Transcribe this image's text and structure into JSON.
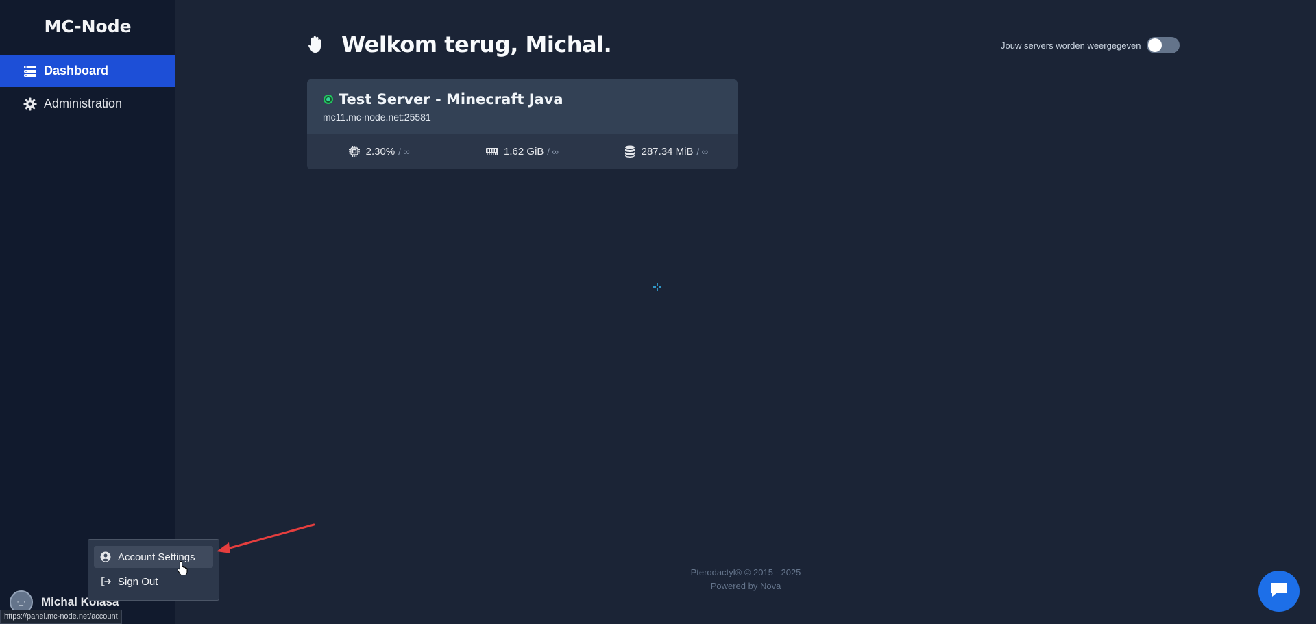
{
  "app": {
    "brand": "MC-Node"
  },
  "sidebar": {
    "items": [
      {
        "label": "Dashboard",
        "icon": "server-stack-icon",
        "active": true
      },
      {
        "label": "Administration",
        "icon": "gear-icon",
        "active": false
      }
    ]
  },
  "user": {
    "name": "Michal Kolasa",
    "avatar_text": "·_·"
  },
  "user_menu": {
    "items": [
      {
        "label": "Account Settings",
        "icon": "user-circle-icon"
      },
      {
        "label": "Sign Out",
        "icon": "sign-out-icon"
      }
    ]
  },
  "status_bar": {
    "url": "https://panel.mc-node.net/account"
  },
  "header": {
    "greeting": "Welkom terug, Michal.",
    "toggle_label": "Jouw servers worden weergegeven",
    "toggle_on": false
  },
  "server": {
    "name": "Test Server - Minecraft Java",
    "address": "mc11.mc-node.net:25581",
    "status": "online",
    "cpu": "2.30%",
    "cpu_limit": "/ ∞",
    "memory": "1.62 GiB",
    "memory_limit": "/ ∞",
    "disk": "287.34 MiB",
    "disk_limit": "/ ∞"
  },
  "footer": {
    "copyright": "Pterodactyl® © 2015 - 2025",
    "powered": "Powered by Nova"
  },
  "colors": {
    "background": "#1b2436",
    "sidebar": "#111a2d",
    "accent": "#1d4fd7",
    "card": "#334155",
    "online": "#22c55e",
    "chat": "#1d6fe8",
    "arrow": "#e53e3e"
  }
}
